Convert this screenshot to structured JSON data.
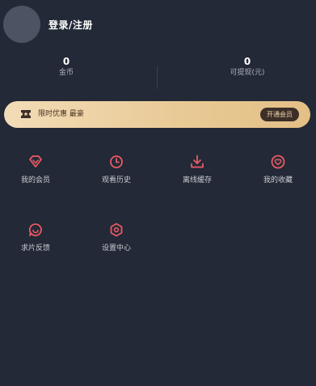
{
  "header": {
    "login_label": "登录/注册"
  },
  "stats": {
    "coins": {
      "value": "0",
      "label": "金币"
    },
    "withdrawable": {
      "value": "0",
      "label": "可提现(元)"
    }
  },
  "vip_banner": {
    "text": "限时优惠 最豪",
    "button_label": "开通会员",
    "icon": "ticket-icon"
  },
  "menu": {
    "items": [
      {
        "label": "我的会员",
        "icon": "diamond-icon"
      },
      {
        "label": "观看历史",
        "icon": "clock-icon"
      },
      {
        "label": "离线缓存",
        "icon": "download-icon"
      },
      {
        "label": "我的收藏",
        "icon": "heart-icon"
      },
      {
        "label": "求片反馈",
        "icon": "chat-icon"
      },
      {
        "label": "设置中心",
        "icon": "settings-icon"
      }
    ]
  },
  "colors": {
    "background": "#232936",
    "accent": "#e85a66",
    "banner_gold": "#e8c994",
    "banner_button": "#3c2f28"
  }
}
